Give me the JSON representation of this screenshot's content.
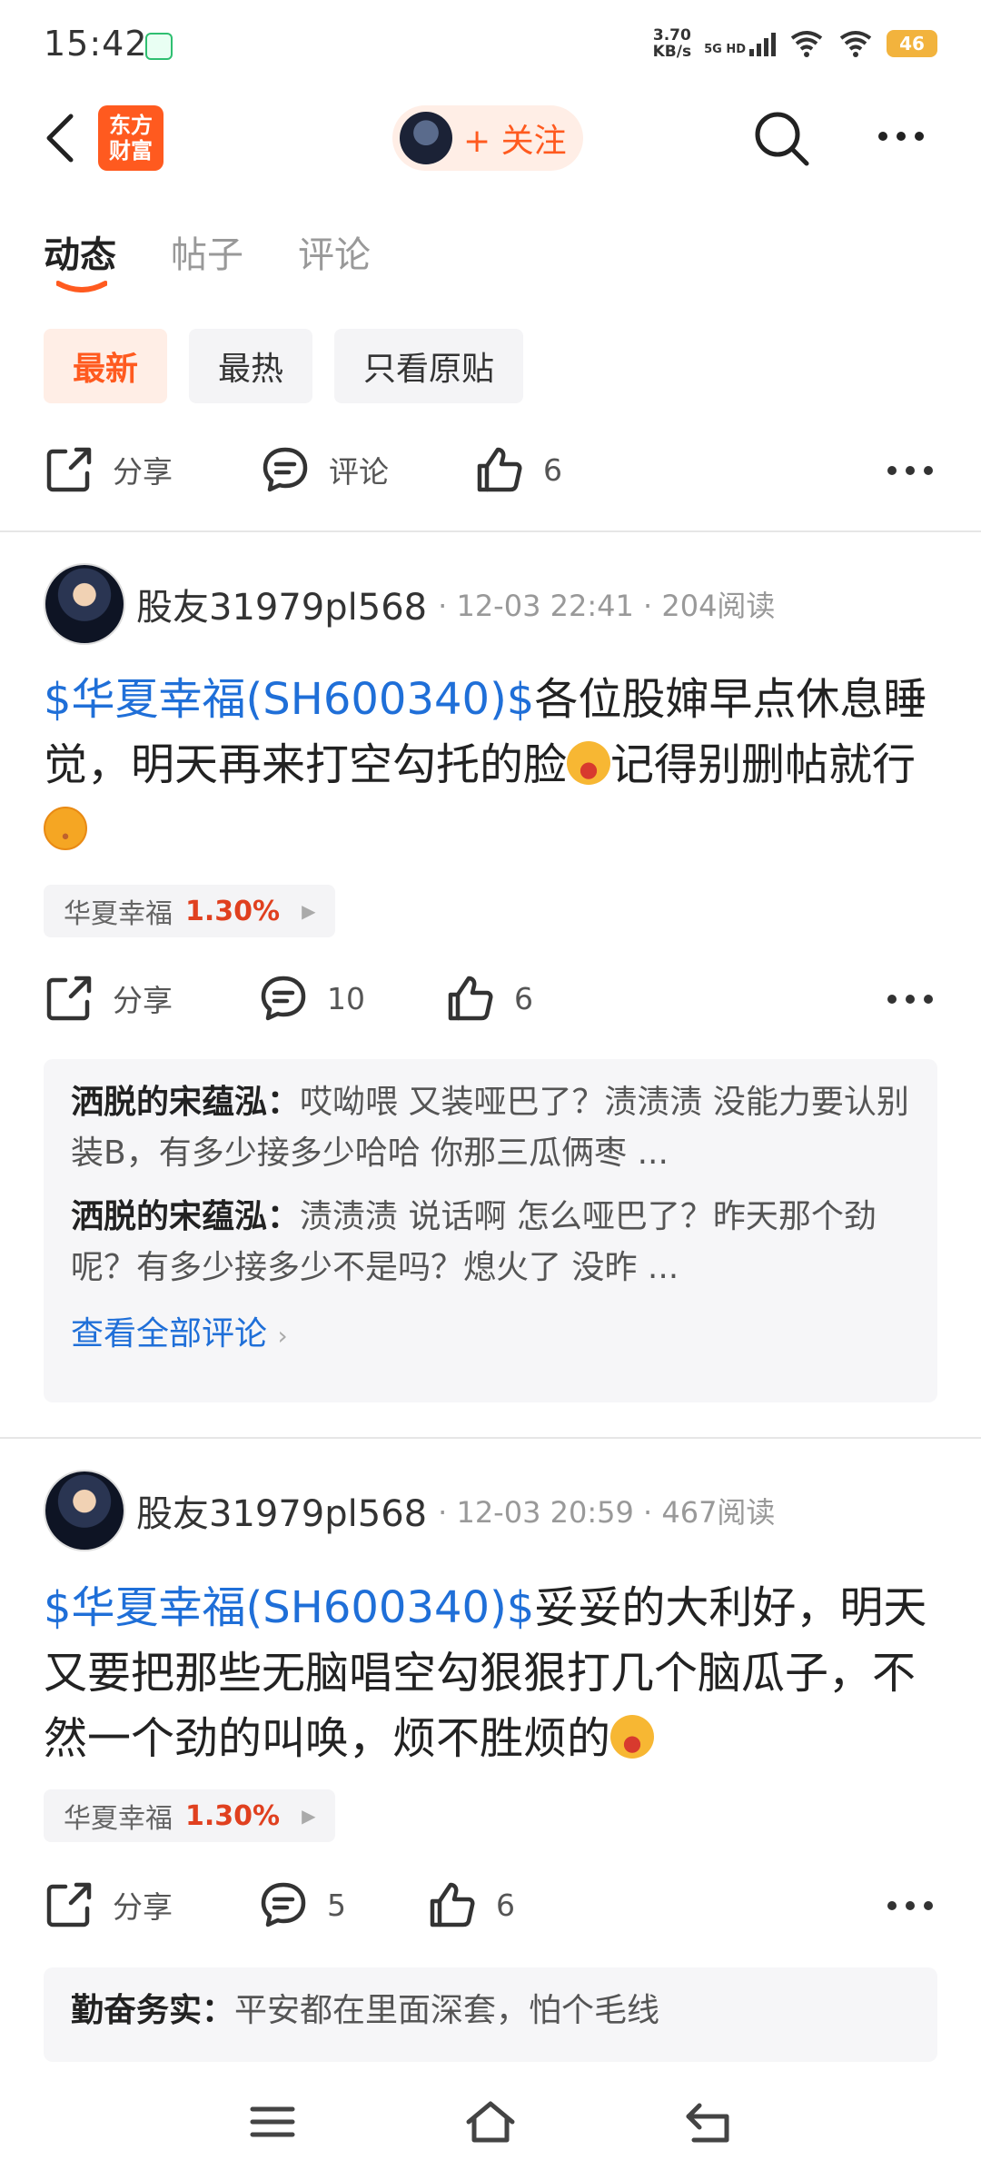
{
  "status": {
    "time": "15:42",
    "speed_value": "3.70",
    "speed_unit": "KB/s",
    "network": "5G HD",
    "battery": "46"
  },
  "header": {
    "logo_line1": "东方",
    "logo_line2": "财富",
    "follow_label": "+ 关注"
  },
  "tabs": [
    {
      "label": "动态",
      "active": true
    },
    {
      "label": "帖子",
      "active": false
    },
    {
      "label": "评论",
      "active": false
    }
  ],
  "filters": [
    {
      "label": "最新",
      "active": true
    },
    {
      "label": "最热",
      "active": false
    },
    {
      "label": "只看原贴",
      "active": false
    }
  ],
  "top_actions": {
    "share": "分享",
    "comment": "评论",
    "likes": "6"
  },
  "posts": [
    {
      "author": "股友31979pl568",
      "meta": "· 12-03 22:41 · 204阅读",
      "stock_link": "$华夏幸福(SH600340)$",
      "text_a": "各位股婶早点休息睡觉，明天再来打空勾托的脸",
      "text_b": "记得别删帖就行",
      "stock_name": "华夏幸福",
      "stock_pct": "1.30%",
      "share": "分享",
      "comments_count": "10",
      "likes": "6",
      "comments": [
        {
          "name": "洒脱的宋蕴泓：",
          "text": "哎呦喂 又装哑巴了？渍渍渍 没能力要认别装B，有多少接多少哈哈 你那三瓜俩枣 ..."
        },
        {
          "name": "洒脱的宋蕴泓：",
          "text": "渍渍渍 说话啊 怎么哑巴了？昨天那个劲呢？有多少接多少不是吗？熄火了 没昨 ..."
        }
      ],
      "view_all": "查看全部评论"
    },
    {
      "author": "股友31979pl568",
      "meta": "· 12-03 20:59 · 467阅读",
      "stock_link": "$华夏幸福(SH600340)$",
      "text_a": "妥妥的大利好，明天又要把那些无脑唱空勾狠狠打几个脑瓜子，不然一个劲的叫唤，烦不胜烦的",
      "stock_name": "华夏幸福",
      "stock_pct": "1.30%",
      "share": "分享",
      "comments_count": "5",
      "likes": "6",
      "comments": [
        {
          "name": "勤奋务实：",
          "text": "平安都在里面深套，怕个毛线"
        }
      ]
    }
  ],
  "colors": {
    "accent": "#ff5a1f",
    "link": "#1f6fd8",
    "gain": "#e0401f"
  }
}
